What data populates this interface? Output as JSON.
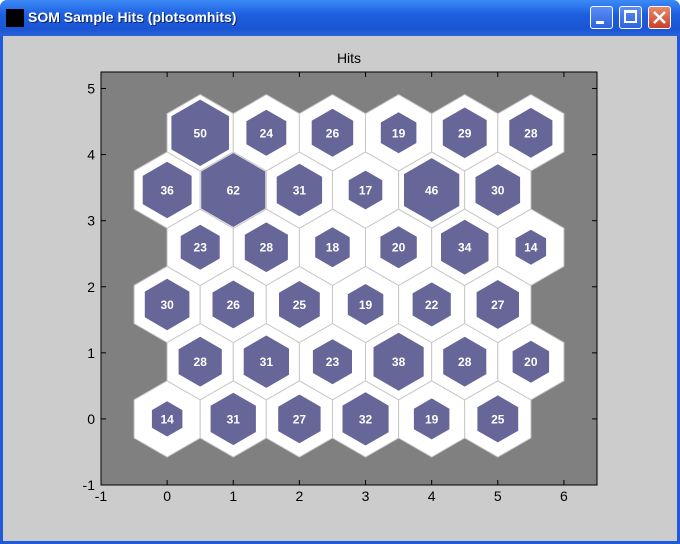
{
  "window": {
    "title": "SOM Sample Hits (plotsomhits)",
    "icon": "matlab-icon"
  },
  "chart_data": {
    "type": "heatmap",
    "title": "Hits",
    "xlabel": "",
    "ylabel": "",
    "xlim": [
      -1,
      6.5
    ],
    "ylim": [
      -1,
      5.25
    ],
    "xticks": [
      "-1",
      "0",
      "1",
      "2",
      "3",
      "4",
      "5",
      "6"
    ],
    "yticks": [
      "-1",
      "0",
      "1",
      "2",
      "3",
      "4",
      "5"
    ],
    "max_hits": 62,
    "rows": [
      {
        "offset": 0,
        "hits": [
          14,
          31,
          27,
          32,
          19,
          25
        ]
      },
      {
        "offset": 0.5,
        "hits": [
          28,
          31,
          23,
          38,
          28,
          20
        ]
      },
      {
        "offset": 0,
        "hits": [
          30,
          26,
          25,
          19,
          22,
          27
        ]
      },
      {
        "offset": 0.5,
        "hits": [
          23,
          28,
          18,
          20,
          34,
          14
        ]
      },
      {
        "offset": 0,
        "hits": [
          36,
          62,
          31,
          17,
          46,
          30
        ]
      },
      {
        "offset": 0.5,
        "hits": [
          50,
          24,
          26,
          19,
          29,
          28
        ]
      }
    ],
    "colors": {
      "background": "#808080",
      "cell": "#ffffff",
      "hit": "#666699",
      "text": "#ffffff",
      "edge": "#c8c8c8"
    }
  }
}
